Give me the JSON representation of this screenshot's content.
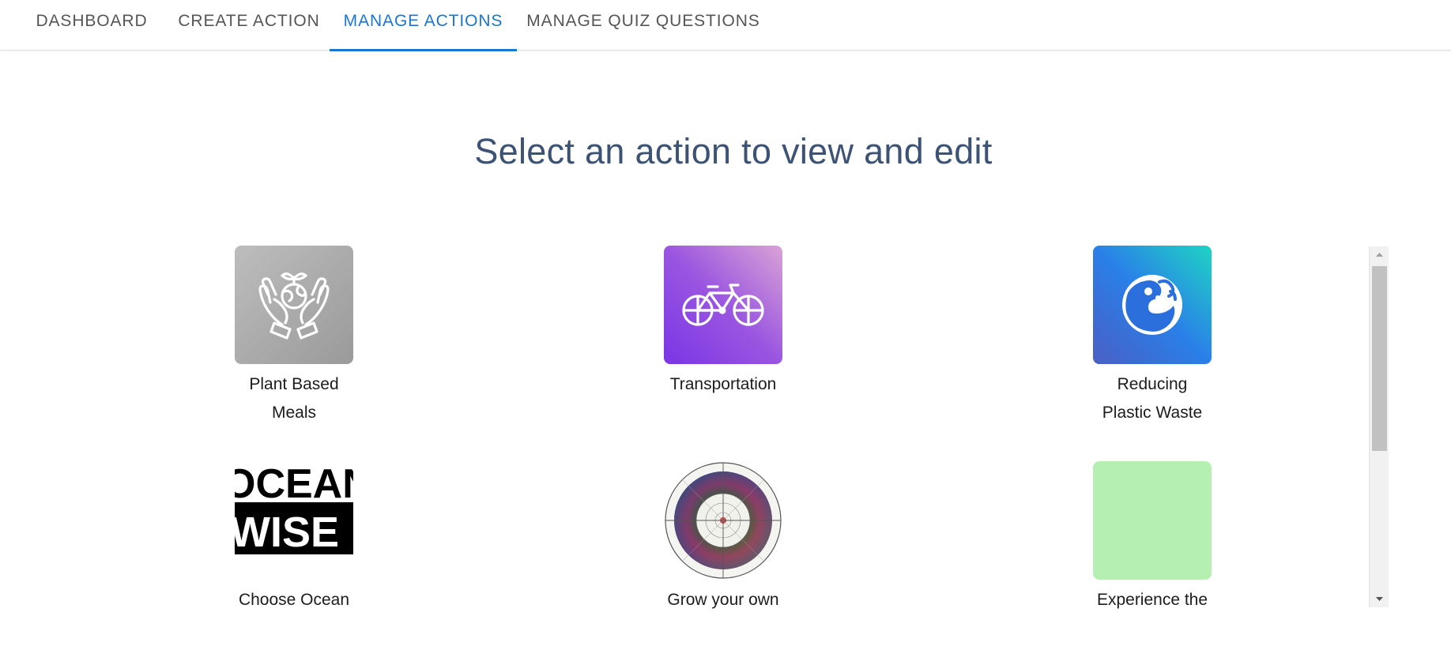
{
  "tabs": [
    {
      "label": "DASHBOARD",
      "active": false
    },
    {
      "label": "CREATE ACTION",
      "active": false
    },
    {
      "label": "MANAGE ACTIONS",
      "active": true
    },
    {
      "label": "MANAGE QUIZ QUESTIONS",
      "active": false
    }
  ],
  "page": {
    "headline": "Select an action to view and edit"
  },
  "actions": [
    {
      "label_lines": [
        "Plant Based",
        "Meals"
      ],
      "icon": "hands-globe-sprout-icon",
      "tile_colors": [
        "#bdbdbd",
        "#9a9a9a"
      ]
    },
    {
      "label_lines": [
        "Transportation"
      ],
      "icon": "bicycle-icon",
      "tile_colors": [
        "#d9a3d6",
        "#7a35e6"
      ]
    },
    {
      "label_lines": [
        "Reducing",
        "Plastic Waste"
      ],
      "icon": "ocean-wave-icon",
      "tile_colors": [
        "#1fd4c4",
        "#2a7fe8",
        "#4a5fc4"
      ]
    },
    {
      "label_lines": [
        "Choose Ocean"
      ],
      "icon": "ocean-wise-logo",
      "logo_text": [
        "OCEAN",
        "WISE"
      ]
    },
    {
      "label_lines": [
        "Grow your own"
      ],
      "icon": "circular-garden-artwork",
      "tile_colors": []
    },
    {
      "label_lines": [
        "Experience the"
      ],
      "icon": "green-square-placeholder",
      "tile_colors": [
        "#b5efb1"
      ]
    }
  ],
  "colors": {
    "accent": "#1976d2",
    "headline": "#3d5375",
    "tab_text": "#555555"
  }
}
